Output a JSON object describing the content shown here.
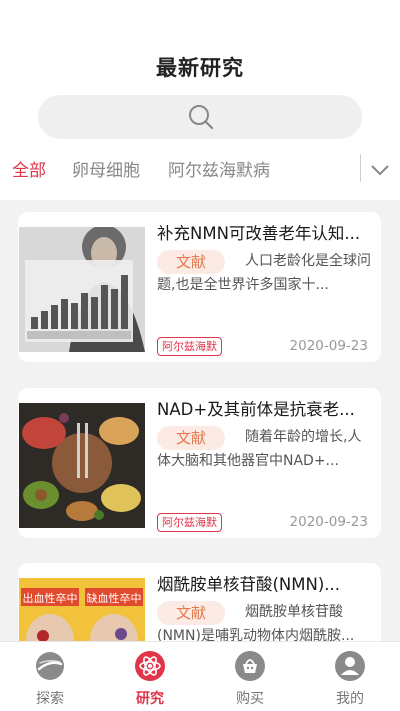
{
  "header": {
    "title": "最新研究",
    "search": {
      "icon": "search-icon"
    }
  },
  "tabs": [
    {
      "label": "全部",
      "active": true
    },
    {
      "label": "卵母细胞",
      "active": false
    },
    {
      "label": "阿尔兹海默病",
      "active": false
    }
  ],
  "tabs_more_icon": "chevron-down-icon",
  "articles": [
    {
      "title": "补充NMN可改善老年认知...",
      "type": "文献",
      "summary": "人口老龄化是全球问题,也是全世界许多国家十...",
      "tag": "阿尔兹海默",
      "date": "2020-09-23"
    },
    {
      "title": "NAD+及其前体是抗衰老...",
      "type": "文献",
      "summary": "随着年龄的增长,人体大脑和其他器官中NAD+...",
      "tag": "阿尔兹海默",
      "date": "2020-09-23"
    },
    {
      "title": "烟酰胺单核苷酸(NMN)...",
      "type": "文献",
      "summary": "烟酰胺单核苷酸(NMN)是哺乳动物体内烟酰胺...",
      "thumb_text": [
        "出血性卒中",
        "缺血性卒中"
      ]
    }
  ],
  "bottom_nav": [
    {
      "label": "探索",
      "icon": "explore-icon",
      "active": false
    },
    {
      "label": "研究",
      "icon": "research-atom-icon",
      "active": true
    },
    {
      "label": "购买",
      "icon": "shopping-basket-icon",
      "active": false
    },
    {
      "label": "我的",
      "icon": "profile-icon",
      "active": false
    }
  ],
  "colors": {
    "accent": "#e0344a",
    "badge_bg": "#fcebe4",
    "badge_text": "#e57a4e",
    "page_bg": "#f2f2f2"
  }
}
